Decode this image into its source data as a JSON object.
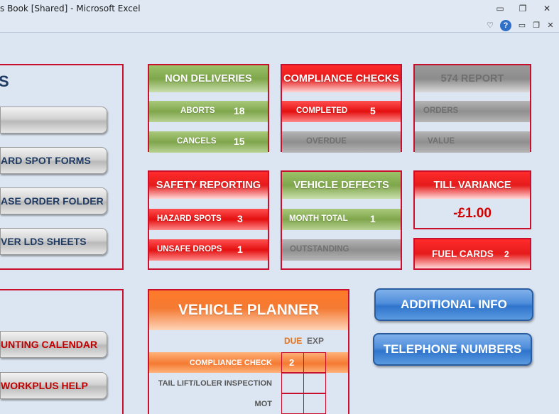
{
  "window": {
    "title": "s Book  [Shared]  -  Microsoft Excel",
    "minimize": "▭",
    "restore": "❐",
    "close": "✕"
  },
  "ribbon": {
    "collapse": "♡",
    "help": "?",
    "minimize": "▭",
    "restore": "❐",
    "close": "✕"
  },
  "left_panel": {
    "title_fragment": "S",
    "buttons": [
      "",
      "ARD SPOT FORMS",
      "ASE ORDER FOLDER",
      "VER LDS SHEETS"
    ]
  },
  "left_panel_2": {
    "buttons": [
      "UNTING CALENDAR",
      "WORKPLUS HELP"
    ]
  },
  "non_deliveries": {
    "title": "NON DELIVERIES",
    "rows": [
      {
        "label": "ABORTS",
        "value": "18"
      },
      {
        "label": "CANCELS",
        "value": "15"
      }
    ]
  },
  "compliance_checks": {
    "title": "COMPLIANCE CHECKS",
    "rows": [
      {
        "label": "COMPLETED",
        "value": "5"
      },
      {
        "label": "OVERDUE",
        "value": ""
      }
    ]
  },
  "report_574": {
    "title": "574 REPORT",
    "rows": [
      {
        "label": "ORDERS",
        "value": ""
      },
      {
        "label": "VALUE",
        "value": ""
      }
    ]
  },
  "safety_reporting": {
    "title": "SAFETY REPORTING",
    "rows": [
      {
        "label": "HAZARD SPOTS",
        "value": "3"
      },
      {
        "label": "UNSAFE DROPS",
        "value": "1"
      }
    ]
  },
  "vehicle_defects": {
    "title": "VEHICLE DEFECTS",
    "rows": [
      {
        "label": "MONTH TOTAL",
        "value": "1"
      },
      {
        "label": "OUTSTANDING",
        "value": ""
      }
    ]
  },
  "till_variance": {
    "title": "TILL VARIANCE",
    "value": "-£1.00"
  },
  "fuel_cards": {
    "label": "FUEL CARDS",
    "value": "2"
  },
  "vehicle_planner": {
    "title": "VEHICLE PLANNER",
    "columns": [
      "DUE",
      "EXP"
    ],
    "rows": [
      {
        "label": "COMPLIANCE CHECK",
        "due": "2",
        "exp": ""
      },
      {
        "label": "TAIL LIFT/LOLER INSPECTION",
        "due": "",
        "exp": ""
      },
      {
        "label": "MOT",
        "due": "",
        "exp": ""
      }
    ]
  },
  "buttons": {
    "additional_info": "ADDITIONAL INFO",
    "telephone_numbers": "TELEPHONE NUMBERS"
  },
  "colors": {
    "frame_red": "#c8102e",
    "green": "#7ea64a",
    "red": "#e51b1b",
    "orange": "#f47a32",
    "blue": "#2f74cc",
    "background": "#dce6f2"
  }
}
